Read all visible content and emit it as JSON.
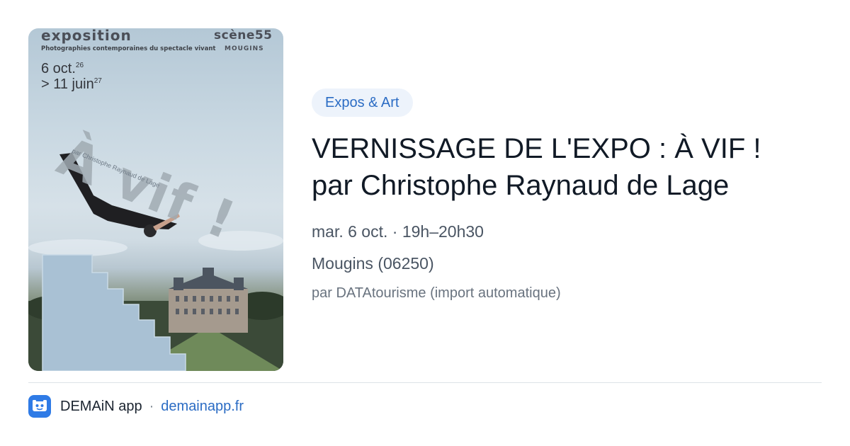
{
  "poster": {
    "heading": "exposition",
    "subheading": "Photographies contemporaines du spectacle vivant",
    "brand": "scène55",
    "brand_sub": "MOUGINS",
    "date_start": "6 oct.",
    "date_start_year": "26",
    "date_end": "> 11 juin",
    "date_end_year": "27",
    "artwork_title": "À vif !",
    "artwork_by": "par Christophe Raynaud de Lage"
  },
  "category_tag": "Expos & Art",
  "event": {
    "title_line1": "VERNISSAGE DE L'EXPO : À VIF !",
    "title_line2": "par Christophe Raynaud de Lage",
    "when": "mar. 6 oct. · 19h–20h30",
    "where": "Mougins (06250)",
    "source": "par DATAtourisme (import automatique)"
  },
  "footer": {
    "app_name": "DEMAiN app",
    "separator": "·",
    "domain": "demainapp.fr",
    "icon": "demain-app-icon"
  },
  "colors": {
    "accent": "#2b6cc4",
    "tag_bg": "#edf3fb",
    "title": "#111a26",
    "meta": "#4a5563"
  }
}
